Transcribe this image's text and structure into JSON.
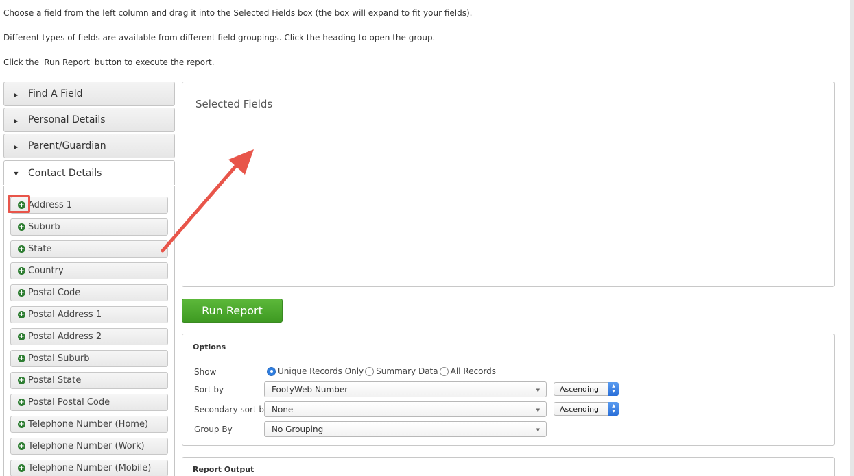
{
  "instructions": [
    "Choose a field from the left column and drag it into the Selected Fields box (the box will expand to fit your fields).",
    "Different types of fields are available from different field groupings. Click the heading to open the group.",
    "Click the 'Run Report' button to execute the report."
  ],
  "groups": {
    "find_a_field": "Find A Field",
    "personal_details": "Personal Details",
    "parent_guardian": "Parent/Guardian",
    "contact_details": "Contact Details"
  },
  "contact_fields": [
    "Address 1",
    "Suburb",
    "State",
    "Country",
    "Postal Code",
    "Postal Address 1",
    "Postal Address 2",
    "Postal Suburb",
    "Postal State",
    "Postal Postal Code",
    "Telephone Number (Home)",
    "Telephone Number (Work)",
    "Telephone Number (Mobile)"
  ],
  "selected_fields": {
    "title": "Selected Fields"
  },
  "run_report_label": "Run Report",
  "options": {
    "title": "Options",
    "show_label": "Show",
    "show_choices": [
      "Unique Records Only",
      "Summary Data",
      "All Records"
    ],
    "show_selected": "Unique Records Only",
    "sort_by_label": "Sort by",
    "sort_by_value": "FootyWeb Number",
    "sort_by_order": "Ascending",
    "secondary_sort_label": "Secondary sort by",
    "secondary_sort_value": "None",
    "secondary_sort_order": "Ascending",
    "group_by_label": "Group By",
    "group_by_value": "No Grouping"
  },
  "report_output": {
    "title": "Report Output"
  },
  "colors": {
    "accent_green": "#3e9a22",
    "annotation_red": "#e8554a",
    "radio_blue": "#2f7ee0",
    "plus_icon_green": "#2e7d32"
  }
}
